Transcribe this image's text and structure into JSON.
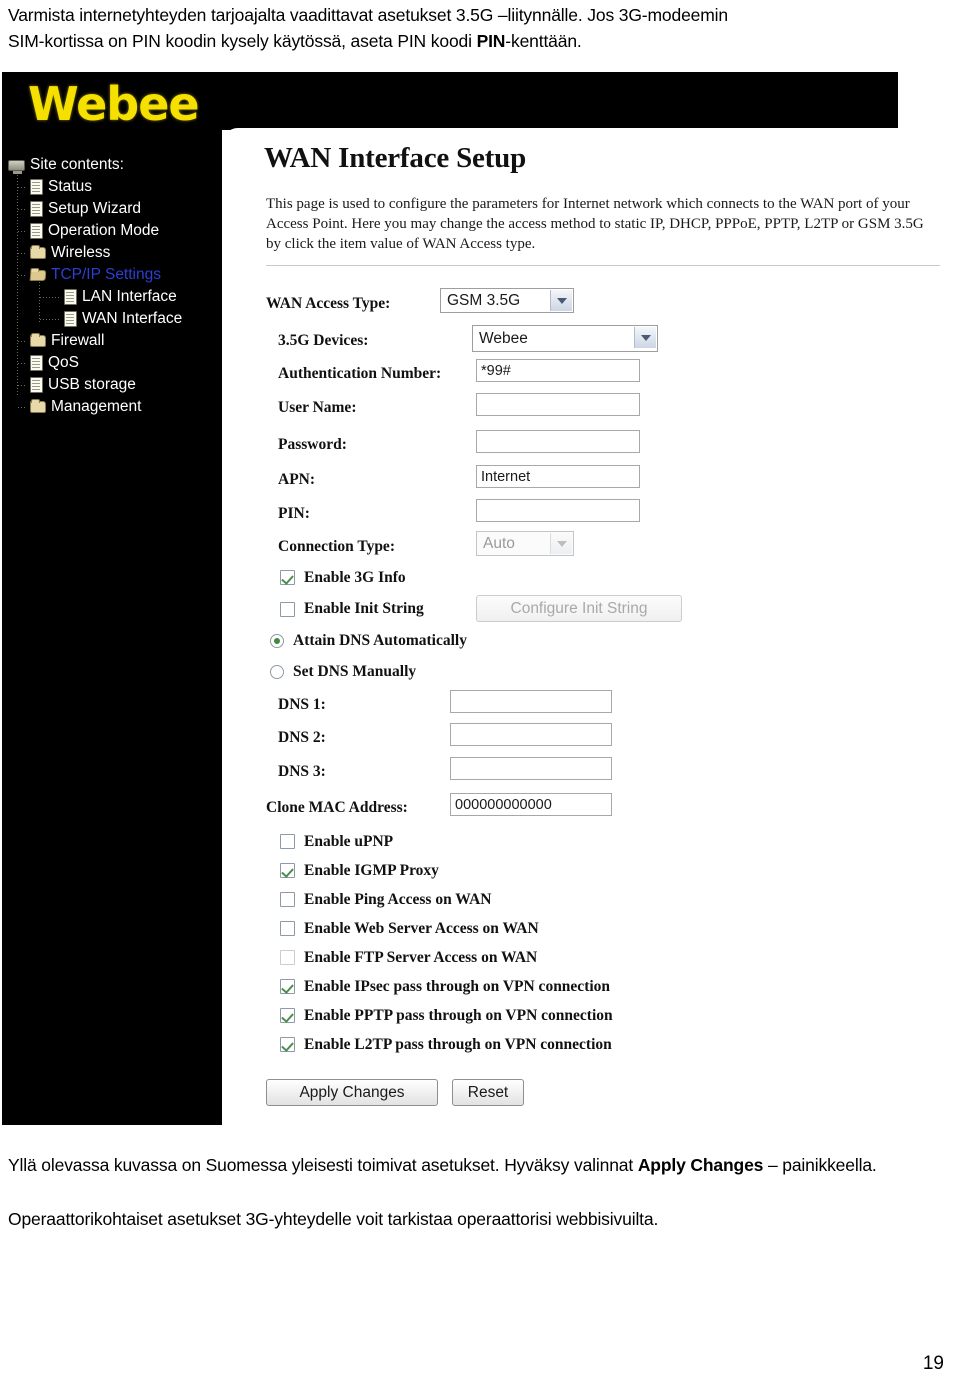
{
  "document": {
    "intro_line1": "Varmista internetyhteyden tarjoajalta vaadittavat asetukset 3.5G –liitynnälle. Jos 3G-modeemin",
    "intro_line2_pre": "SIM-kortissa on PIN koodin kysely käytössä, aseta PIN koodi ",
    "intro_line2_bold": "PIN",
    "intro_line2_post": "-kenttään.",
    "outro_p1_pre": "Yllä olevassa kuvassa on Suomessa yleisesti toimivat asetukset. Hyväksy valinnat ",
    "outro_p1_bold": "Apply Changes",
    "outro_p1_post": " – painikkeella.",
    "outro_p2": "Operaattorikohtaiset asetukset 3G-yhteydelle voit tarkistaa operaattorisi webbisivuilta.",
    "page_number": "19"
  },
  "router_ui": {
    "logo": "Webee",
    "sidebar": {
      "items": [
        {
          "label": "Site contents:",
          "icon": "monitor-icon",
          "indent": 0,
          "selected": false
        },
        {
          "label": "Status",
          "icon": "document-icon",
          "indent": 1,
          "selected": false
        },
        {
          "label": "Setup Wizard",
          "icon": "document-icon",
          "indent": 1,
          "selected": false
        },
        {
          "label": "Operation Mode",
          "icon": "document-icon",
          "indent": 1,
          "selected": false
        },
        {
          "label": "Wireless",
          "icon": "folder-icon",
          "indent": 1,
          "selected": false
        },
        {
          "label": "TCP/IP Settings",
          "icon": "folder-open-icon",
          "indent": 1,
          "selected": true
        },
        {
          "label": "LAN Interface",
          "icon": "document-icon",
          "indent": 2,
          "selected": false
        },
        {
          "label": "WAN Interface",
          "icon": "document-icon",
          "indent": 2,
          "selected": false
        },
        {
          "label": "Firewall",
          "icon": "folder-icon",
          "indent": 1,
          "selected": false
        },
        {
          "label": "QoS",
          "icon": "document-icon",
          "indent": 1,
          "selected": false
        },
        {
          "label": "USB storage",
          "icon": "document-icon",
          "indent": 1,
          "selected": false
        },
        {
          "label": "Management",
          "icon": "folder-icon",
          "indent": 1,
          "selected": false
        }
      ]
    },
    "main": {
      "title": "WAN Interface Setup",
      "description": "This page is used to configure the parameters for Internet network which connects to the WAN port of your Access Point. Here you may change the access method to static IP, DHCP, PPPoE, PPTP, L2TP or GSM 3.5G by click the item value of WAN Access type.",
      "fields": {
        "wan_access_type_label": "WAN Access Type:",
        "wan_access_type_value": "GSM 3.5G",
        "devices_label": "3.5G Devices:",
        "devices_value": "Webee",
        "auth_number_label": "Authentication Number:",
        "auth_number_value": "*99#",
        "user_name_label": "User Name:",
        "user_name_value": "",
        "password_label": "Password:",
        "password_value": "",
        "apn_label": "APN:",
        "apn_value": "Internet",
        "pin_label": "PIN:",
        "pin_value": "",
        "connection_type_label": "Connection Type:",
        "connection_type_value": "Auto",
        "dns1_label": "DNS 1:",
        "dns1_value": "",
        "dns2_label": "DNS 2:",
        "dns2_value": "",
        "dns3_label": "DNS 3:",
        "dns3_value": "",
        "clone_mac_label": "Clone MAC Address:",
        "clone_mac_value": "000000000000"
      },
      "toggles": {
        "enable_3g_info": {
          "label": "Enable 3G Info",
          "checked": true
        },
        "enable_init_string": {
          "label": "Enable Init String",
          "checked": false
        },
        "configure_init_string_button": "Configure Init String"
      },
      "dns_mode": {
        "attain_auto": {
          "label": "Attain DNS Automatically",
          "selected": true
        },
        "set_manual": {
          "label": "Set DNS Manually",
          "selected": false
        }
      },
      "options": [
        {
          "label": "Enable uPNP",
          "checked": false,
          "light": false
        },
        {
          "label": "Enable IGMP Proxy",
          "checked": true,
          "light": false
        },
        {
          "label": "Enable Ping Access on WAN",
          "checked": false,
          "light": false
        },
        {
          "label": "Enable Web Server Access on WAN",
          "checked": false,
          "light": false
        },
        {
          "label": "Enable FTP Server Access on WAN",
          "checked": false,
          "light": true
        },
        {
          "label": "Enable IPsec pass through on VPN connection",
          "checked": true,
          "light": false
        },
        {
          "label": "Enable PPTP pass through on VPN connection",
          "checked": true,
          "light": false
        },
        {
          "label": "Enable L2TP pass through on VPN connection",
          "checked": true,
          "light": false
        }
      ],
      "buttons": {
        "apply": "Apply Changes",
        "reset": "Reset"
      }
    }
  }
}
